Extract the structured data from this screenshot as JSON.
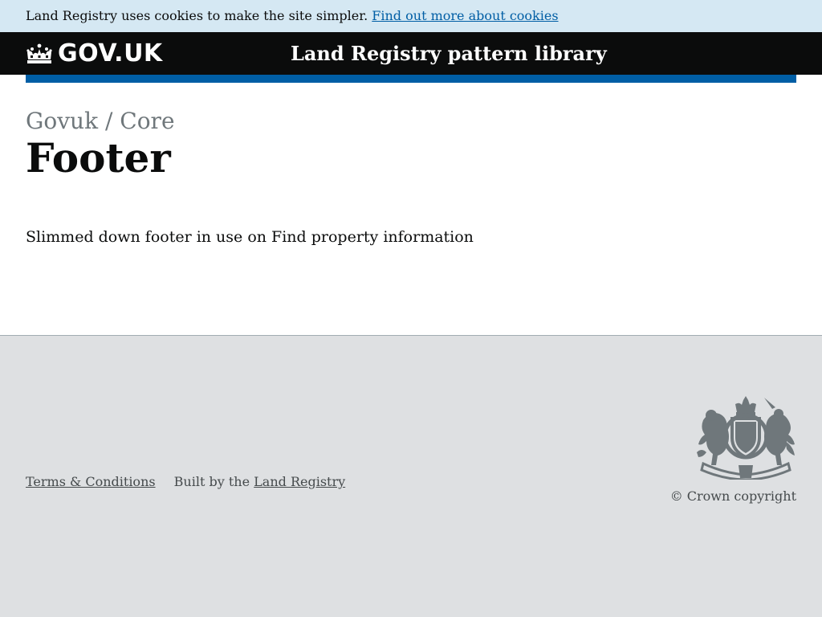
{
  "cookie_banner": {
    "text": "Land Registry uses cookies to make the site simpler.",
    "link_label": "Find out more about cookies"
  },
  "header": {
    "logo_icon": "crown-icon",
    "logo_text": "GOV.UK",
    "service_name": "Land Registry pattern library",
    "accent_color": "#005ea5"
  },
  "main": {
    "breadcrumb": "Govuk / Core",
    "title": "Footer",
    "description": "Slimmed down footer in use on Find property information"
  },
  "footer": {
    "terms_label": "Terms & Conditions",
    "built_by_prefix": "Built by the",
    "built_by_link": "Land Registry",
    "crest_icon": "royal-coat-of-arms-icon",
    "copyright": "© Crown copyright"
  }
}
